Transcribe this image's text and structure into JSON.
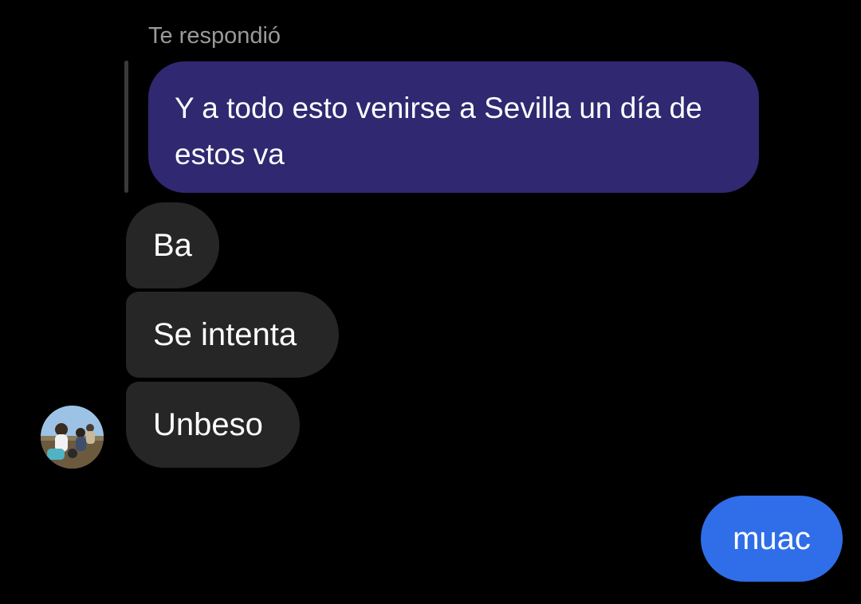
{
  "reply_context": {
    "header": "Te respondió",
    "quoted_text": "Y a todo esto venirse a Sevilla un día de estos va"
  },
  "messages": [
    {
      "direction": "incoming",
      "text": "Ba"
    },
    {
      "direction": "incoming",
      "text": "Se intenta"
    },
    {
      "direction": "incoming",
      "text": "Unbeso"
    },
    {
      "direction": "outgoing",
      "text": "muac"
    }
  ],
  "colors": {
    "background": "#000000",
    "incoming_bubble": "#262626",
    "outgoing_bubble": "#2f6ee8",
    "quoted_bubble": "#302870",
    "reply_header_text": "#9a9a9a"
  }
}
